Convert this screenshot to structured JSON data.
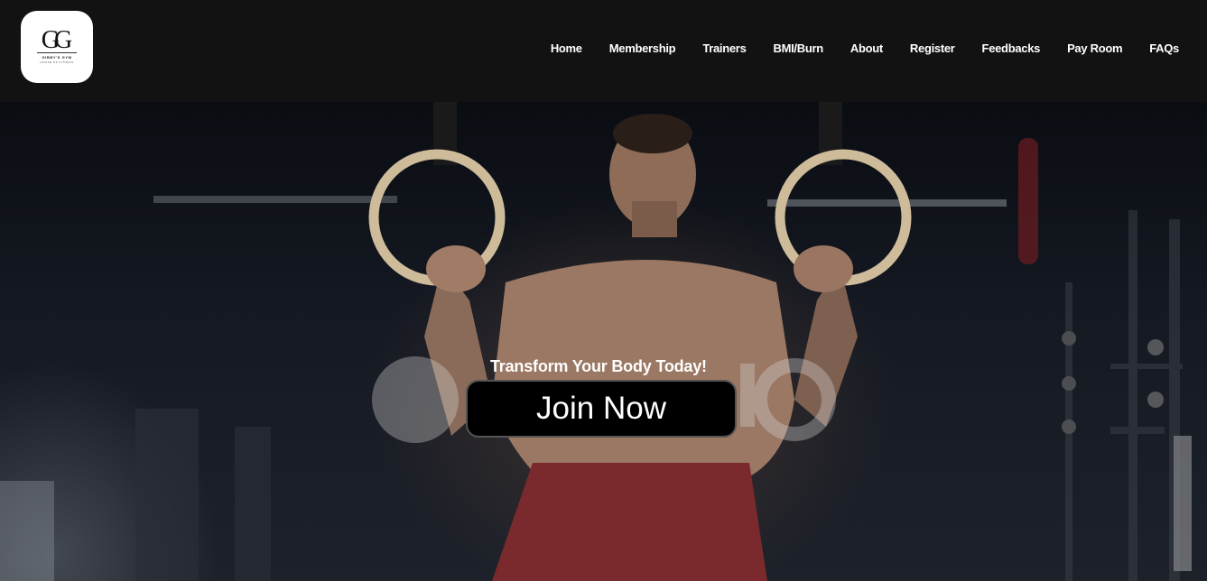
{
  "brand": {
    "monogram": "GG",
    "name": "GIBBY'S GYM",
    "tagline": "HOUSE OF FITNESS"
  },
  "nav": {
    "items": [
      {
        "label": "Home"
      },
      {
        "label": "Membership"
      },
      {
        "label": "Trainers"
      },
      {
        "label": "BMI/Burn"
      },
      {
        "label": "About"
      },
      {
        "label": "Register"
      },
      {
        "label": "Feedbacks"
      },
      {
        "label": "Pay Room"
      },
      {
        "label": "FAQs"
      }
    ]
  },
  "hero": {
    "caption": "Transform Your Body Today!",
    "cta_label": "Join Now",
    "background": "gym-rings-video"
  },
  "colors": {
    "navbar": "#121212",
    "button": "#000000",
    "text": "#ffffff",
    "shorts": "#7a2a2c"
  }
}
